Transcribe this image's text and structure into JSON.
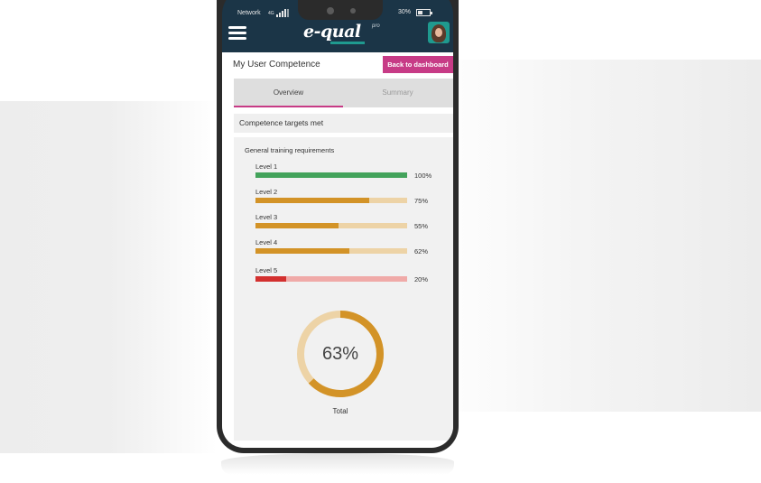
{
  "status_bar": {
    "network_label": "Network",
    "network_type": "4G",
    "battery_percent": "30%"
  },
  "header": {
    "logo_text": "e-qual",
    "logo_suffix": "pro",
    "menu_icon": "hamburger-icon",
    "avatar_icon": "user-avatar"
  },
  "page": {
    "title": "My User Competence",
    "back_button_label": "Back to dashboard"
  },
  "tabs": [
    {
      "label": "Overview",
      "active": true
    },
    {
      "label": "Summary",
      "active": false
    }
  ],
  "section": {
    "targets_label": "Competence targets met",
    "card_title": "General training requirements"
  },
  "colors": {
    "header_bg": "#1b3547",
    "accent": "#c73b86",
    "teal": "#1f9a8f",
    "complete": "#43a35b",
    "partial": "#d39327",
    "partial_track": "#edd3a6",
    "low": "#d3302f",
    "low_track": "#f0aaa8"
  },
  "levels": [
    {
      "label": "Level 1",
      "value": 100,
      "pct_label": "100%",
      "status": "complete"
    },
    {
      "label": "Level 2",
      "value": 75,
      "pct_label": "75%",
      "status": "partial"
    },
    {
      "label": "Level 3",
      "value": 55,
      "pct_label": "55%",
      "status": "partial"
    },
    {
      "label": "Level 4",
      "value": 62,
      "pct_label": "62%",
      "status": "partial"
    },
    {
      "label": "Level 5",
      "value": 20,
      "pct_label": "20%",
      "status": "low"
    }
  ],
  "total": {
    "value": 63,
    "pct_label": "63%",
    "label": "Total"
  }
}
